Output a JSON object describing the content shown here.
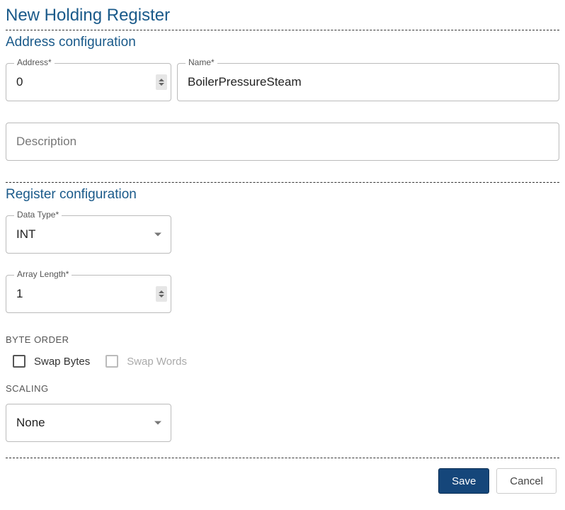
{
  "title": "New Holding Register",
  "addressSection": {
    "title": "Address configuration",
    "addressLabel": "Address*",
    "addressValue": "0",
    "nameLabel": "Name*",
    "nameValue": "BoilerPressureSteam",
    "descriptionPlaceholder": "Description",
    "descriptionValue": ""
  },
  "registerSection": {
    "title": "Register configuration",
    "dataTypeLabel": "Data Type*",
    "dataTypeValue": "INT",
    "arrayLengthLabel": "Array Length*",
    "arrayLengthValue": "1",
    "byteOrderTitle": "BYTE ORDER",
    "swapBytesLabel": "Swap Bytes",
    "swapBytesChecked": false,
    "swapWordsLabel": "Swap Words",
    "swapWordsChecked": false,
    "swapWordsDisabled": true,
    "scalingTitle": "SCALING",
    "scalingValue": "None"
  },
  "footer": {
    "saveLabel": "Save",
    "cancelLabel": "Cancel"
  }
}
